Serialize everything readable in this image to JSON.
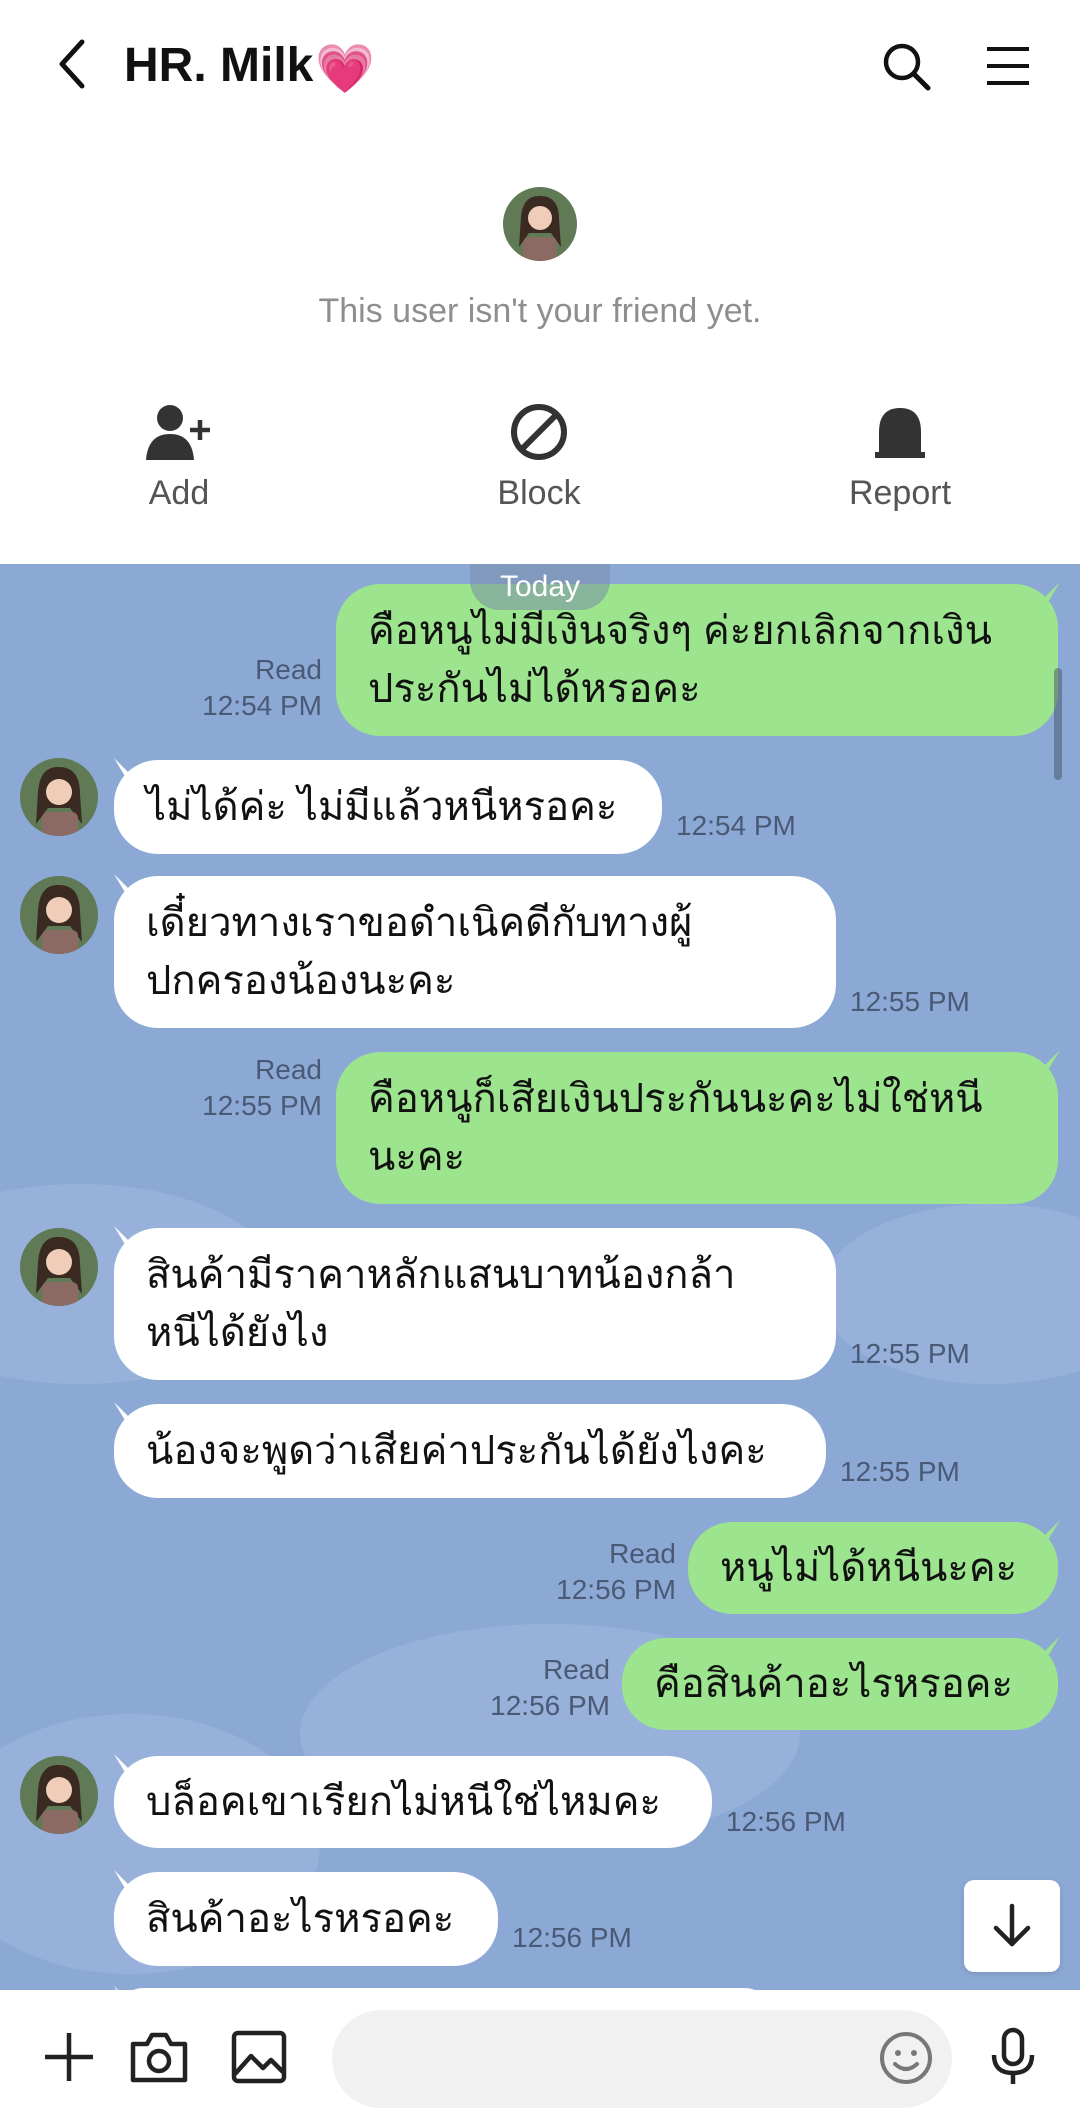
{
  "header": {
    "title": "HR. Milk",
    "title_emoji": "💗"
  },
  "notice": {
    "text": "This user isn't your friend yet.",
    "actions": [
      {
        "label": "Add",
        "icon": "add-friend-icon"
      },
      {
        "label": "Block",
        "icon": "block-icon"
      },
      {
        "label": "Report",
        "icon": "report-icon"
      }
    ]
  },
  "chat": {
    "date_label": "Today",
    "messages": [
      {
        "from": "me",
        "text_line1": "คือหนูไม่มีเงินจริงๆ ค่ะยกเลิกจากเงิน",
        "text_line2": "ประกันไม่ได้หรอคะ",
        "status": "Read",
        "time": "12:54 PM"
      },
      {
        "from": "other",
        "text": "ไม่ได้ค่ะ ไม่มีแล้วหนีหรอคะ",
        "time": "12:54 PM"
      },
      {
        "from": "other",
        "text_line1": "เดี๋ยวทางเราขอดำเนิคดีกับทางผู้",
        "text_line2": "ปกครองน้องนะคะ",
        "time": "12:55 PM"
      },
      {
        "from": "me",
        "text_line1": "คือหนูก็เสียเงินประกันนะคะไม่ใช่หนี",
        "text_line2": "นะคะ",
        "status": "Read",
        "time": "12:55 PM"
      },
      {
        "from": "other",
        "text_line1": "สินค้ามีราคาหลักแสนบาทน้องกล้า",
        "text_line2": "หนีได้ยังไง",
        "time": "12:55 PM"
      },
      {
        "from": "other",
        "text": "น้องจะพูดว่าเสียค่าประกันได้ยังไงคะ",
        "time": "12:55 PM"
      },
      {
        "from": "me",
        "text": "หนูไม่ได้หนีนะคะ",
        "status": "Read",
        "time": "12:56 PM"
      },
      {
        "from": "me",
        "text": "คือสินค้าอะไรหรอคะ",
        "status": "Read",
        "time": "12:56 PM"
      },
      {
        "from": "other",
        "text": "บล็อคเขาเรียกไม่หนีใช่ไหมคะ",
        "time": "12:56 PM"
      },
      {
        "from": "other",
        "text": "สินค้าอะไรหรอคะ",
        "time": "12:56 PM"
      }
    ]
  },
  "input": {
    "placeholder": ""
  },
  "colors": {
    "chat_bg": "#8ca9d6",
    "my_bubble": "#9ce48d",
    "other_bubble": "#ffffff"
  }
}
